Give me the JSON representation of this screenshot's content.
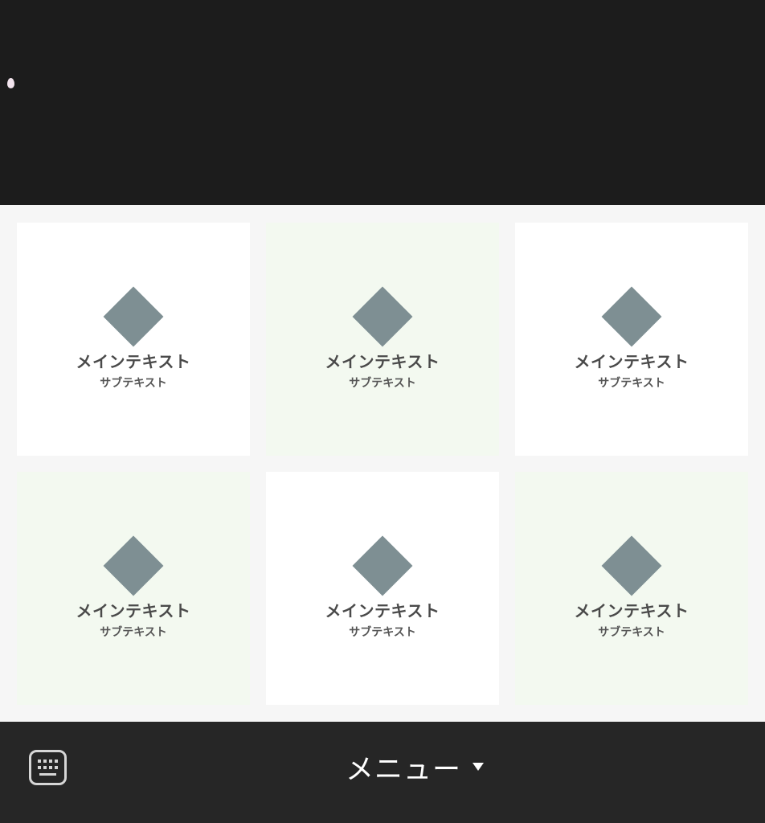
{
  "colors": {
    "top_background": "#1c1c1c",
    "grid_background": "#f6f6f6",
    "tile_white": "#ffffff",
    "tile_green": "#f3f9f0",
    "diamond": "#7e8f93",
    "bottom_bar": "#262626"
  },
  "tiles": [
    {
      "main": "メインテキスト",
      "sub": "サブテキスト",
      "icon": "diamond-icon",
      "bg": "white"
    },
    {
      "main": "メインテキスト",
      "sub": "サブテキスト",
      "icon": "diamond-icon",
      "bg": "green"
    },
    {
      "main": "メインテキスト",
      "sub": "サブテキスト",
      "icon": "diamond-icon",
      "bg": "white"
    },
    {
      "main": "メインテキスト",
      "sub": "サブテキスト",
      "icon": "diamond-icon",
      "bg": "green"
    },
    {
      "main": "メインテキスト",
      "sub": "サブテキスト",
      "icon": "diamond-icon",
      "bg": "white"
    },
    {
      "main": "メインテキスト",
      "sub": "サブテキスト",
      "icon": "diamond-icon",
      "bg": "green"
    }
  ],
  "bottom_bar": {
    "keyboard_icon": "keyboard-icon",
    "menu_label": "メニュー",
    "caret_icon": "caret-down-icon"
  }
}
